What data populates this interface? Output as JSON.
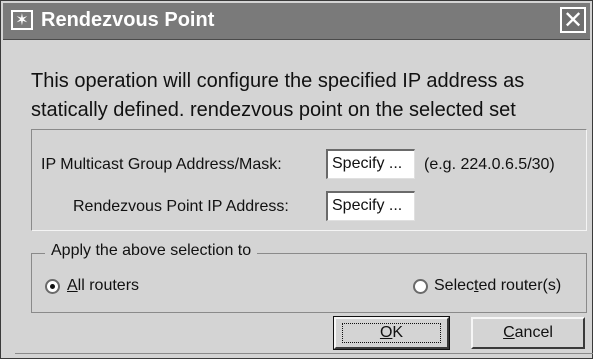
{
  "window": {
    "title": "Rendezvous Point",
    "close_label": "✕"
  },
  "description": "This operation will configure the specified IP address as\nstatically defined. rendezvous point on the selected set",
  "form": {
    "multicast_label": "IP Multicast Group Address/Mask:",
    "multicast_value": "Specify ...",
    "multicast_example": "(e.g. 224.0.6.5/30)",
    "rp_label": "Rendezvous Point IP Address:",
    "rp_value": "Specify ..."
  },
  "apply_group": {
    "legend": "Apply the above selection to",
    "options": [
      {
        "label_prefix": "",
        "label_mnemonic": "A",
        "label_suffix": "ll routers",
        "selected": true
      },
      {
        "label_prefix": "Selec",
        "label_mnemonic": "t",
        "label_suffix": "ed router(s)",
        "selected": false
      }
    ]
  },
  "buttons": {
    "ok_mnemonic": "O",
    "ok_suffix": "K",
    "cancel_mnemonic": "C",
    "cancel_suffix": "ancel"
  },
  "colors": {
    "dialog_bg": "#d4d4d4",
    "titlebar_bg": "#7a7a7a",
    "title_text": "#ffffff"
  },
  "icons": {
    "window_icon": "star-icon",
    "close_icon": "close-icon"
  }
}
